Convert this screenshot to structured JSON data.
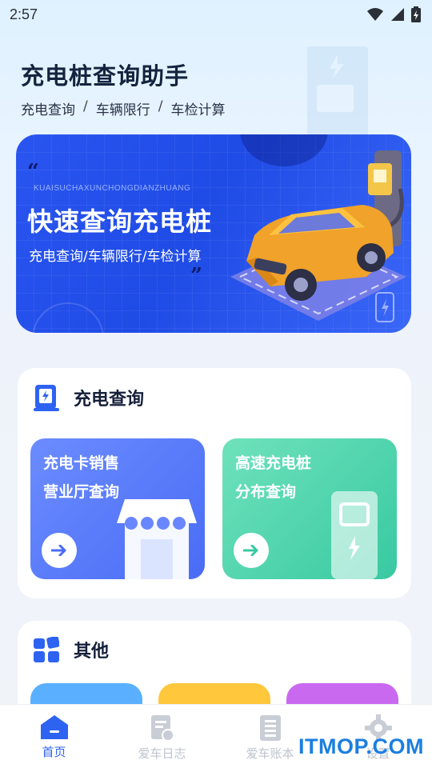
{
  "status_bar": {
    "time": "2:57"
  },
  "header": {
    "title": "充电桩查询助手",
    "breadcrumb": [
      "充电查询",
      "车辆限行",
      "车检计算"
    ],
    "separator": "/"
  },
  "banner": {
    "pinyin": "KUAISUCHAXUNCHONGDIANZHUANG",
    "title": "快速查询充电桩",
    "subtitle": "充电查询/车辆限行/车检计算"
  },
  "charge_section": {
    "title": "充电查询",
    "tiles": [
      {
        "line1": "充电卡销售",
        "line2": "营业厅查询",
        "color": "#5a7bf7"
      },
      {
        "line1": "高速充电桩",
        "line2": "分布查询",
        "color": "#4fd3ad"
      }
    ]
  },
  "other_section": {
    "title": "其他",
    "pill_colors": [
      "#5ab0ff",
      "#ffc73c",
      "#c969f0"
    ]
  },
  "bottom_nav": [
    {
      "label": "首页",
      "icon": "home-icon",
      "active": true
    },
    {
      "label": "爱车日志",
      "icon": "log-icon",
      "active": false
    },
    {
      "label": "爱车账本",
      "icon": "ledger-icon",
      "active": false
    },
    {
      "label": "设置",
      "icon": "gear-icon",
      "active": false
    }
  ],
  "watermark": "ITMOP.COM",
  "colors": {
    "accent": "#2e63f1",
    "banner": "#2a55f0"
  }
}
